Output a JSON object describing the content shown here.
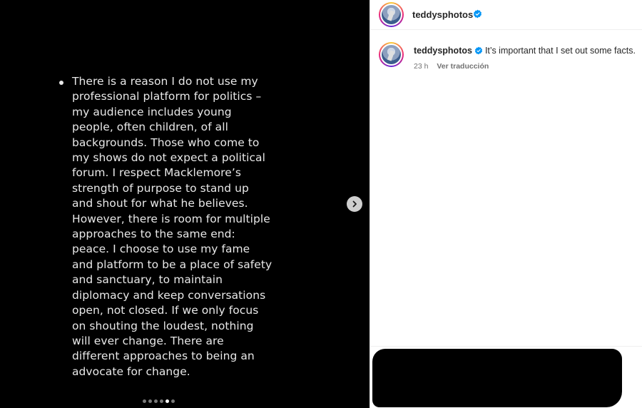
{
  "post": {
    "slide_text": "There is a reason I do not use my professional platform for politics – my audience includes young people, often children, of all backgrounds. Those who come to my shows do not expect a political forum. I respect Macklemore’s strength of purpose to stand up and shout for what he believes. However, there is room for multiple approaches to the same end: peace. I choose to use my fame and platform to be a place of safety and sanctuary, to maintain diplomacy and keep conversations open, not closed. If we only focus on shouting the loudest, nothing will ever change. There are different approaches to being an advocate for change.",
    "slides_total": 6,
    "slide_active": 5
  },
  "header": {
    "username": "teddysphotos"
  },
  "caption": {
    "username": "teddysphotos",
    "text": "It’s important that I set out some facts.",
    "time": "23 h",
    "translate_label": "Ver traducción"
  },
  "colors": {
    "verified": "#0095f6",
    "background_media": "#000000",
    "panel": "#ffffff",
    "redaction": "#000000"
  },
  "icons": {
    "next": "chevron-right-icon",
    "verified": "verified-badge-icon"
  }
}
